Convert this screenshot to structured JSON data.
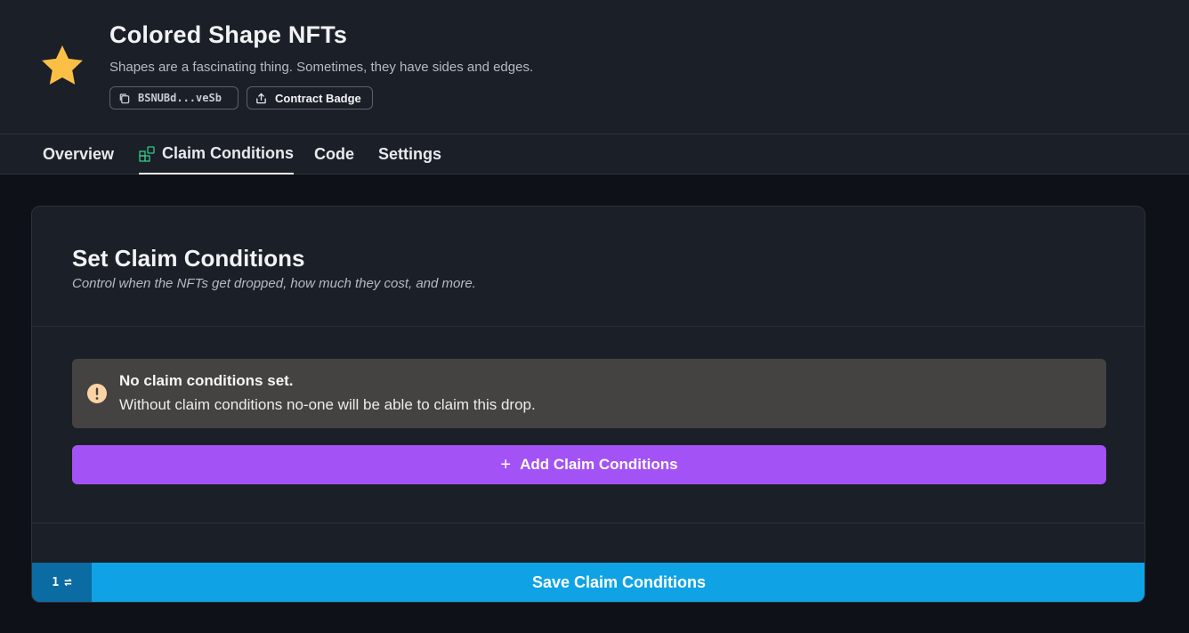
{
  "header": {
    "title": "Colored Shape NFTs",
    "subtitle": "Shapes are a fascinating thing. Sometimes, they have sides and edges.",
    "logo_icon": "star-icon",
    "address": "BSNUBd...veSb",
    "address_icon": "copy-icon",
    "badge_label": "Contract Badge",
    "badge_icon": "share-icon"
  },
  "tabs": [
    {
      "label": "Overview",
      "active": false
    },
    {
      "label": "Claim Conditions",
      "active": true,
      "icon": "claim-conditions-icon"
    },
    {
      "label": "Code",
      "active": false
    },
    {
      "label": "Settings",
      "active": false
    }
  ],
  "card": {
    "title": "Set Claim Conditions",
    "description": "Control when the NFTs get dropped, how much they cost, and more.",
    "alert": {
      "icon": "warning-icon",
      "title": "No claim conditions set.",
      "text": "Without claim conditions no-one will be able to claim this drop."
    },
    "add_button_label": "Add Claim Conditions",
    "save": {
      "count": "1",
      "count_icon": "swap-arrows-icon",
      "label": "Save Claim Conditions"
    }
  },
  "colors": {
    "background": "#0e1117",
    "header_bg": "#1b1f27",
    "accent_purple": "#a352f5",
    "save_blue": "#0fa3e6",
    "counter_blue": "#0b6ba3",
    "star_yellow": "#fbbf45",
    "tab_icon_green": "#34c98a",
    "alert_bg": "#454341",
    "alert_icon": "#fbd3a5"
  }
}
